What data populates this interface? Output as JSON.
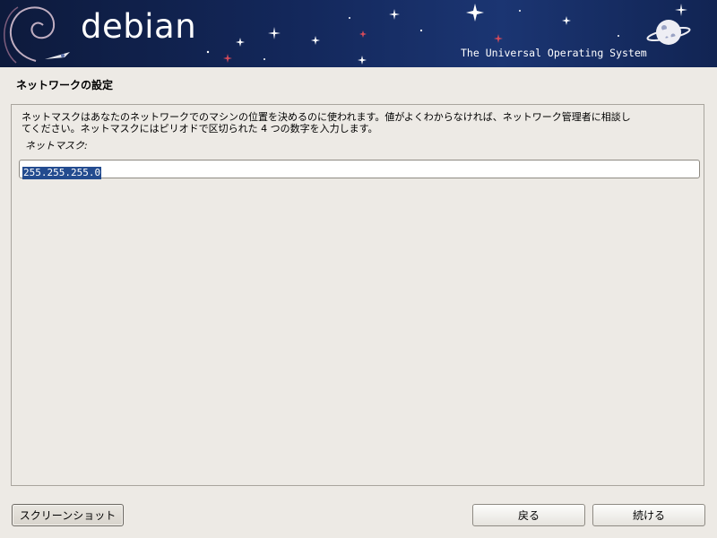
{
  "banner": {
    "logo_text": "debian",
    "tagline": "The Universal Operating System"
  },
  "page": {
    "title": "ネットワークの設定"
  },
  "form": {
    "description_lines": [
      "ネットマスクはあなたのネットワークでのマシンの位置を決めるのに使われます。値がよくわからなければ、ネットワーク管理者に相談し",
      "てください。ネットマスクにはピリオドで区切られた 4 つの数字を入力します。"
    ],
    "field_label": "ネットマスク:",
    "netmask_value": "255.255.255.0"
  },
  "buttons": {
    "screenshot_label": "スクリーンショット",
    "back_label": "戻る",
    "continue_label": "続ける"
  },
  "colors": {
    "banner_bg": "#13275a",
    "page_bg": "#edeae5",
    "selection": "#234b8f"
  }
}
